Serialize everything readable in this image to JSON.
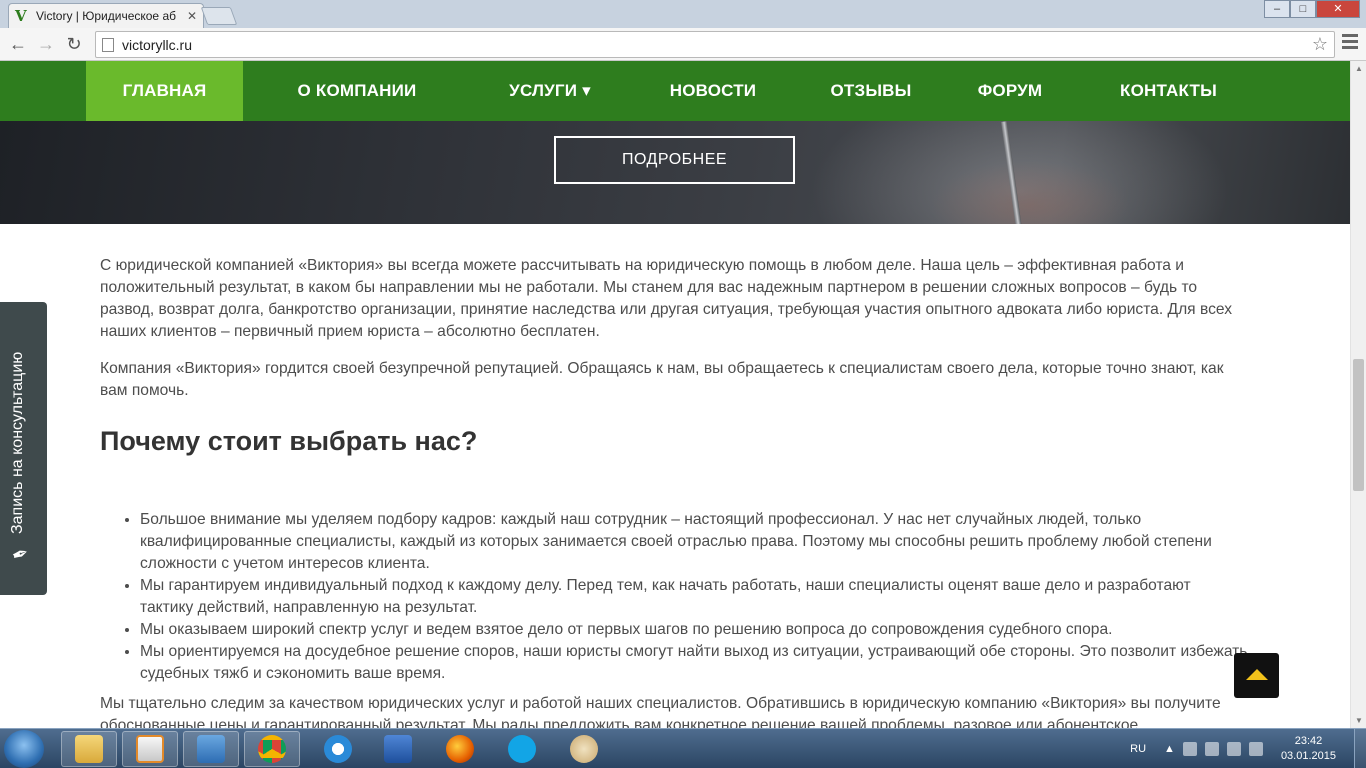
{
  "browser": {
    "tab_title": "Victory | Юридическое аб",
    "url": "victoryllc.ru",
    "favicon_letter": "V"
  },
  "nav": {
    "items": [
      {
        "label": "ГЛАВНАЯ",
        "active": true
      },
      {
        "label": "О КОМПАНИИ"
      },
      {
        "label": "УСЛУГИ ▾"
      },
      {
        "label": "НОВОСТИ"
      },
      {
        "label": "ОТЗЫВЫ"
      },
      {
        "label": "ФОРУМ"
      },
      {
        "label": "КОНТАКТЫ"
      }
    ]
  },
  "hero": {
    "button_label": "ПОДРОБНЕЕ"
  },
  "content": {
    "intro_p1": "С юридической компанией «Виктория» вы всегда можете рассчитывать на юридическую помощь в любом деле. Наша цель – эффективная работа и положительный результат, в каком бы направлении мы не работали. Мы станем для вас надежным партнером в решении сложных вопросов – будь то развод, возврат долга, банкротство организации, принятие наследства или другая ситуация, требующая участия опытного адвоката либо юриста. Для всех наших клиентов – первичный прием юриста – абсолютно бесплатен.",
    "intro_p2": "Компания «Виктория» гордится своей безупречной репутацией. Обращаясь к нам, вы обращаетесь к специалистам своего дела, которые точно знают, как вам помочь.",
    "heading": "Почему стоит выбрать нас?",
    "bullets": [
      "Большое внимание мы уделяем подбору кадров: каждый наш сотрудник – настоящий профессионал. У нас нет случайных людей, только квалифицированные специалисты, каждый из которых занимается своей отраслью права. Поэтому мы способны решить проблему любой степени сложности с учетом интересов клиента.",
      "Мы гарантируем индивидуальный подход к каждому делу. Перед тем, как начать работать, наши специалисты оценят ваше дело и разработают тактику действий, направленную на результат.",
      "Мы оказываем широкий спектр услуг и ведем взятое дело от первых шагов по решению вопроса до сопровождения судебного спора.",
      "Мы ориентируемся на досудебное решение споров, наши юристы смогут найти выход из ситуации, устраивающий обе стороны. Это позволит избежать судебных тяжб и сэкономить ваше время."
    ],
    "outro_p": "Мы тщательно следим за качеством юридических услуг и работой наших специалистов. Обратившись в юридическую компанию «Виктория» вы получите обоснованные цены и гарантированный результат. Мы рады предложить вам конкретное решение вашей проблемы, разовое или абонентское"
  },
  "sidetab": {
    "label": "Запись на консультацию"
  },
  "taskbar": {
    "lang": "RU",
    "time": "23:42",
    "date": "03.01.2015"
  }
}
